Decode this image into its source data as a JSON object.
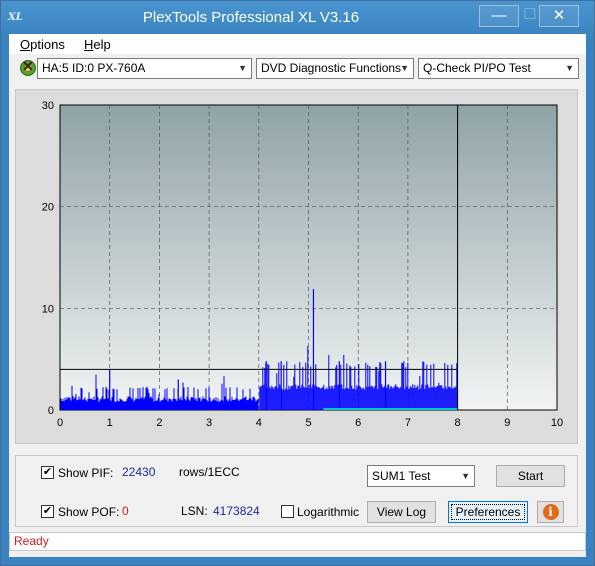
{
  "window": {
    "title": "PlexTools Professional XL V3.16",
    "app_icon_text": "XL",
    "minimize_glyph": "—",
    "maximize_glyph": "☐",
    "close_glyph": "✕"
  },
  "menu": {
    "items": [
      {
        "label": "Options",
        "underline": "O",
        "rest": "ptions"
      },
      {
        "label": "Help",
        "underline": "H",
        "rest": "elp"
      }
    ]
  },
  "toolbar": {
    "drive": "HA:5 ID:0  PX-760A",
    "function": "DVD Diagnostic Functions",
    "test": "Q-Check PI/PO Test",
    "arrow": "▼"
  },
  "chart_data": {
    "type": "bar",
    "x_ticks": [
      "0",
      "1",
      "2",
      "3",
      "4",
      "5",
      "6",
      "7",
      "8",
      "9",
      "10"
    ],
    "y_ticks": [
      "0",
      "10",
      "20",
      "30"
    ],
    "xlim": [
      0,
      10
    ],
    "ylim": [
      0,
      30
    ],
    "grid": true,
    "threshold_line": 4,
    "end_marker_x": 8,
    "colors": {
      "bars": "#0000ff",
      "po": "#00c8c8",
      "bg_top": "#8fa3a7",
      "bg_bottom": "#f2f4f4"
    },
    "series": [
      {
        "x_range": [
          0,
          4
        ],
        "baseline": 0.8,
        "noise": 1.5
      },
      {
        "x_range": [
          4,
          8
        ],
        "baseline": 2.0,
        "noise": 2.8
      }
    ],
    "spikes": [
      {
        "x": 1.0,
        "y": 4.0
      },
      {
        "x": 2.38,
        "y": 3.0
      },
      {
        "x": 4.15,
        "y": 4.8
      },
      {
        "x": 4.45,
        "y": 4.8
      },
      {
        "x": 5.1,
        "y": 11.9
      },
      {
        "x": 5.62,
        "y": 4.8
      },
      {
        "x": 6.55,
        "y": 4.8
      }
    ]
  },
  "controls": {
    "show_pif_label": "Show PIF:",
    "pif_value": "22430",
    "pif_unit": "rows/1ECC",
    "show_pof_label": "Show POF:",
    "pof_value": "0",
    "lsn_label": "LSN:",
    "lsn_value": "4173824",
    "logarithmic_label": "Logarithmic",
    "sum_select": "SUM1 Test",
    "start_label": "Start",
    "view_log_label": "View Log",
    "preferences_label": "Preferences",
    "check_glyph": "✔",
    "info_glyph": "i"
  },
  "status": {
    "text": "Ready"
  }
}
